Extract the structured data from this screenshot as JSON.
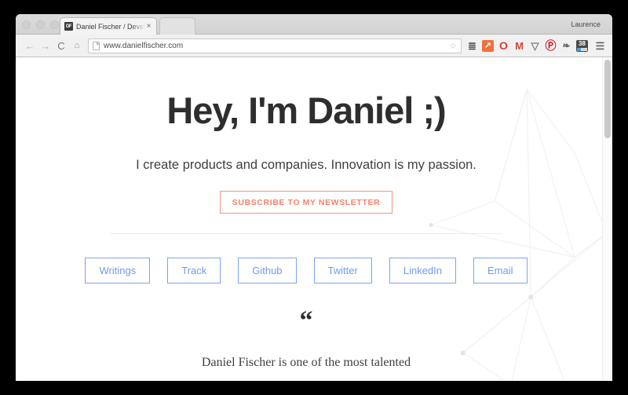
{
  "browser": {
    "profile_label": "Laurence",
    "tab": {
      "favicon_text": "DF",
      "title": "Daniel Fischer / Developer, D",
      "close_label": "×"
    },
    "nav": {
      "back": "←",
      "forward": "→",
      "reload": "C",
      "home": "⌂"
    },
    "omnibox": {
      "url": "www.danielfischer.com",
      "star": "☆"
    },
    "extensions": [
      {
        "name": "pocket-stack-icon",
        "glyph": "≣"
      },
      {
        "name": "analytics-icon",
        "glyph": "↗"
      },
      {
        "name": "opera-icon",
        "glyph": "O"
      },
      {
        "name": "gmail-icon",
        "glyph": "M"
      },
      {
        "name": "pocket-icon",
        "glyph": "▽"
      },
      {
        "name": "pinterest-icon",
        "glyph": "Ⓟ"
      },
      {
        "name": "evernote-icon",
        "glyph": "❧"
      },
      {
        "name": "counter-badge-icon",
        "glyph": "38"
      }
    ],
    "menu_glyph": "☰"
  },
  "page": {
    "title": "Hey, I'm Daniel ;)",
    "subtitle": "I create products and companies. Innovation is my passion.",
    "cta_label": "SUBSCRIBE TO MY NEWSLETTER",
    "links": [
      {
        "label": "Writings"
      },
      {
        "label": "Track"
      },
      {
        "label": "Github"
      },
      {
        "label": "Twitter"
      },
      {
        "label": "LinkedIn"
      },
      {
        "label": "Email"
      }
    ],
    "quote_mark": "“",
    "quote_text": "Daniel Fischer is one of the most talented"
  },
  "colors": {
    "accent_coral": "#f4846a",
    "accent_blue": "#6f9bf2",
    "text_dark": "#2e2e2e"
  }
}
